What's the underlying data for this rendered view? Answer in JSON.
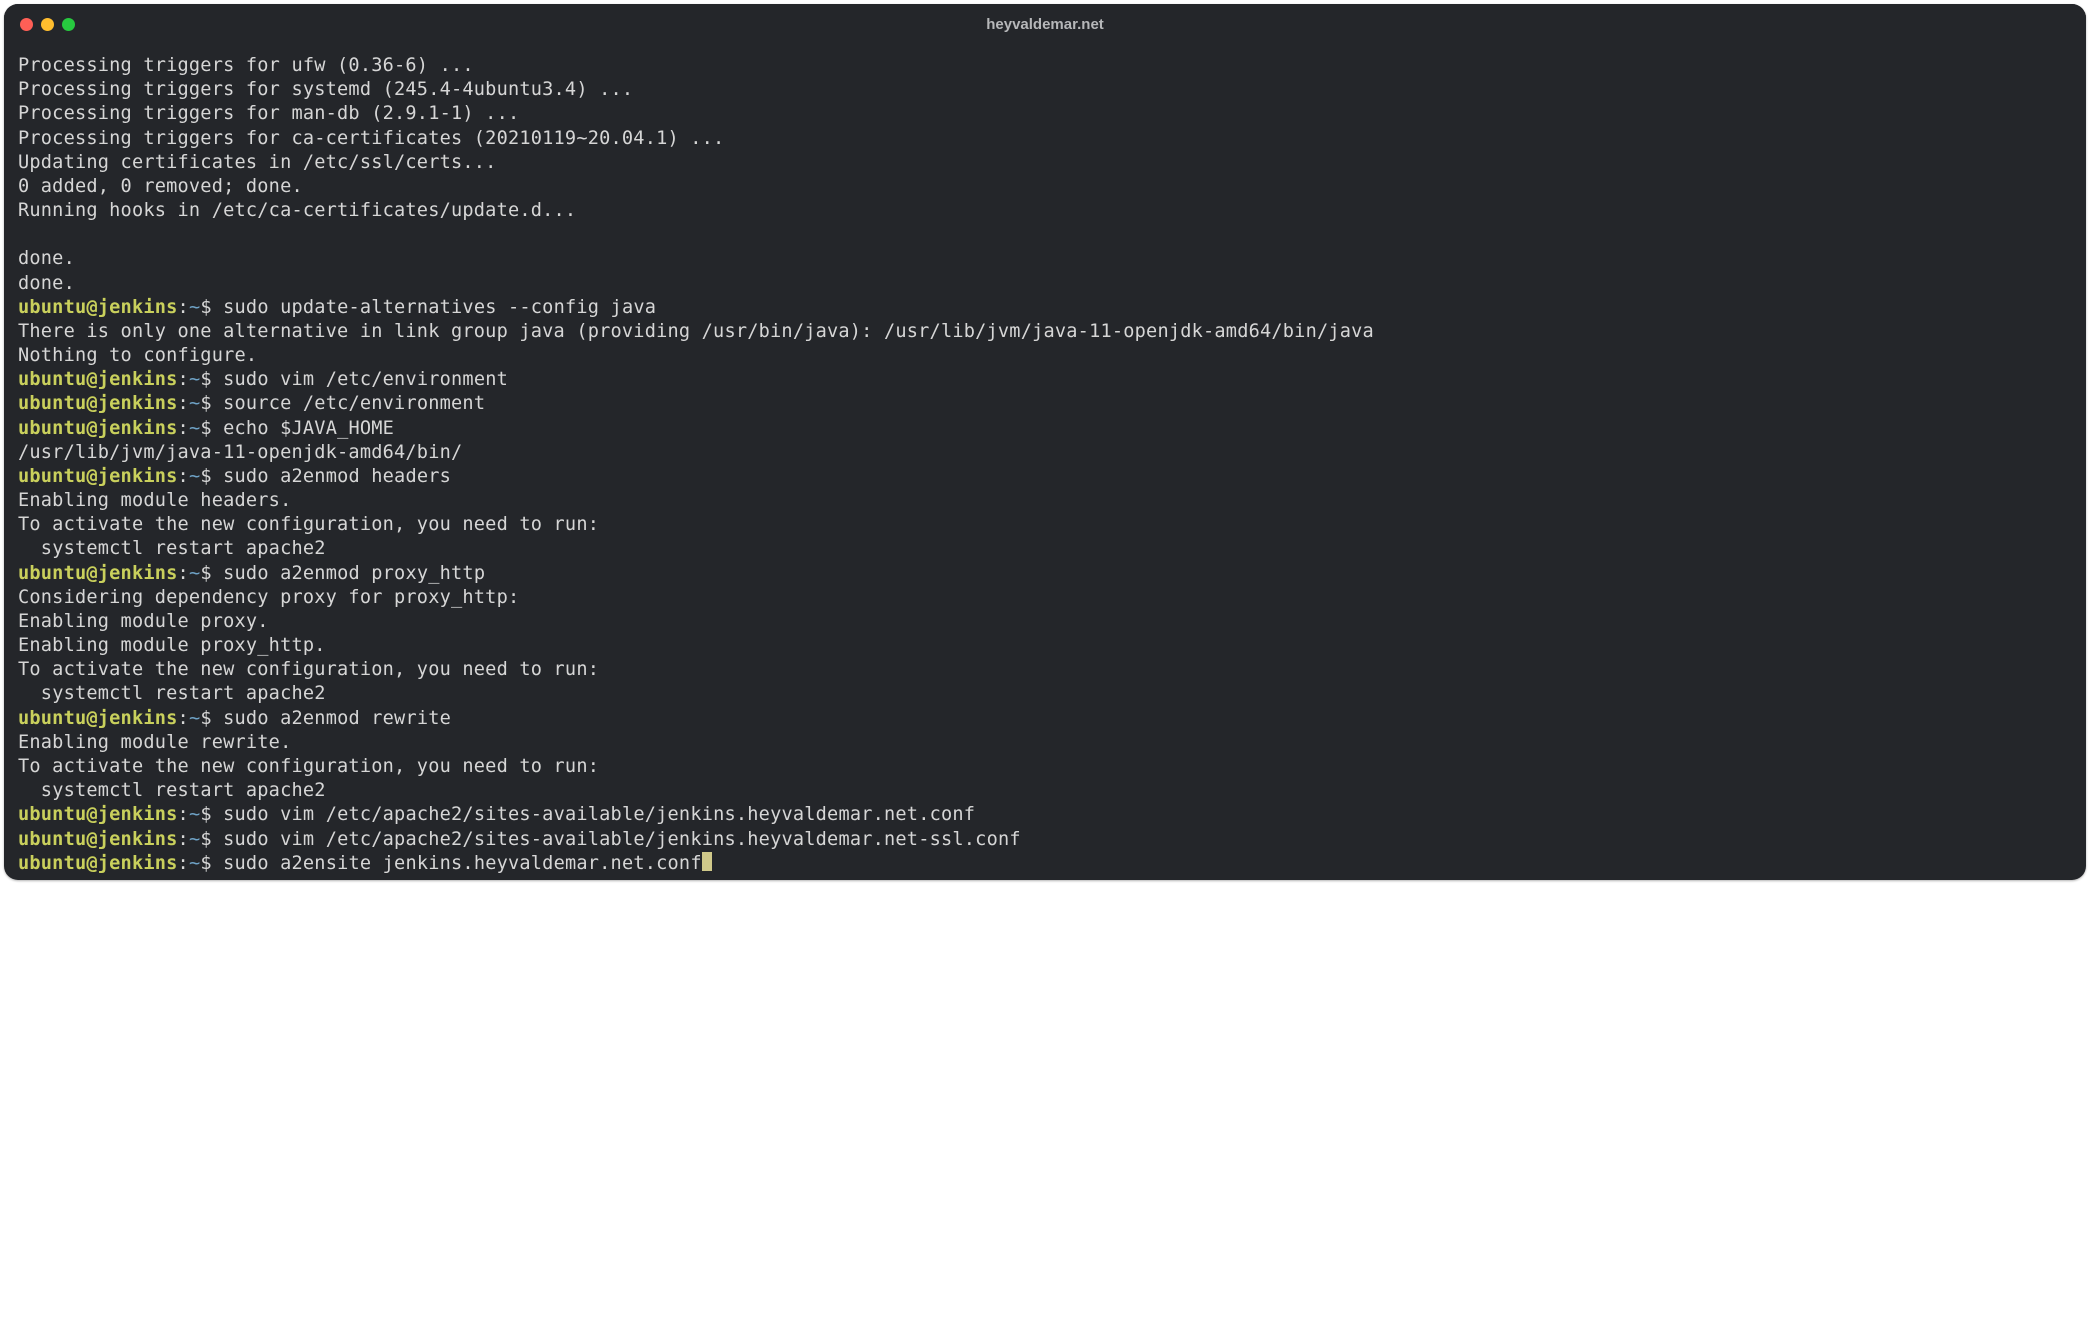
{
  "window": {
    "title": "heyvaldemar.net"
  },
  "prompt": {
    "user_host": "ubuntu@jenkins",
    "sep": ":",
    "cwd": "~",
    "marker": "$"
  },
  "lines": [
    {
      "type": "out",
      "text": "Processing triggers for ufw (0.36-6) ..."
    },
    {
      "type": "out",
      "text": "Processing triggers for systemd (245.4-4ubuntu3.4) ..."
    },
    {
      "type": "out",
      "text": "Processing triggers for man-db (2.9.1-1) ..."
    },
    {
      "type": "out",
      "text": "Processing triggers for ca-certificates (20210119~20.04.1) ..."
    },
    {
      "type": "out",
      "text": "Updating certificates in /etc/ssl/certs..."
    },
    {
      "type": "out",
      "text": "0 added, 0 removed; done."
    },
    {
      "type": "out",
      "text": "Running hooks in /etc/ca-certificates/update.d..."
    },
    {
      "type": "out",
      "text": ""
    },
    {
      "type": "out",
      "text": "done."
    },
    {
      "type": "out",
      "text": "done."
    },
    {
      "type": "cmd",
      "text": "sudo update-alternatives --config java"
    },
    {
      "type": "out",
      "text": "There is only one alternative in link group java (providing /usr/bin/java): /usr/lib/jvm/java-11-openjdk-amd64/bin/java"
    },
    {
      "type": "out",
      "text": "Nothing to configure."
    },
    {
      "type": "cmd",
      "text": "sudo vim /etc/environment"
    },
    {
      "type": "cmd",
      "text": "source /etc/environment"
    },
    {
      "type": "cmd",
      "text": "echo $JAVA_HOME"
    },
    {
      "type": "out",
      "text": "/usr/lib/jvm/java-11-openjdk-amd64/bin/"
    },
    {
      "type": "cmd",
      "text": "sudo a2enmod headers"
    },
    {
      "type": "out",
      "text": "Enabling module headers."
    },
    {
      "type": "out",
      "text": "To activate the new configuration, you need to run:"
    },
    {
      "type": "out",
      "text": "  systemctl restart apache2"
    },
    {
      "type": "cmd",
      "text": "sudo a2enmod proxy_http"
    },
    {
      "type": "out",
      "text": "Considering dependency proxy for proxy_http:"
    },
    {
      "type": "out",
      "text": "Enabling module proxy."
    },
    {
      "type": "out",
      "text": "Enabling module proxy_http."
    },
    {
      "type": "out",
      "text": "To activate the new configuration, you need to run:"
    },
    {
      "type": "out",
      "text": "  systemctl restart apache2"
    },
    {
      "type": "cmd",
      "text": "sudo a2enmod rewrite"
    },
    {
      "type": "out",
      "text": "Enabling module rewrite."
    },
    {
      "type": "out",
      "text": "To activate the new configuration, you need to run:"
    },
    {
      "type": "out",
      "text": "  systemctl restart apache2"
    },
    {
      "type": "cmd",
      "text": "sudo vim /etc/apache2/sites-available/jenkins.heyvaldemar.net.conf"
    },
    {
      "type": "cmd",
      "text": "sudo vim /etc/apache2/sites-available/jenkins.heyvaldemar.net-ssl.conf"
    },
    {
      "type": "cmd",
      "text": "sudo a2ensite jenkins.heyvaldemar.net.conf",
      "cursor": true
    }
  ]
}
